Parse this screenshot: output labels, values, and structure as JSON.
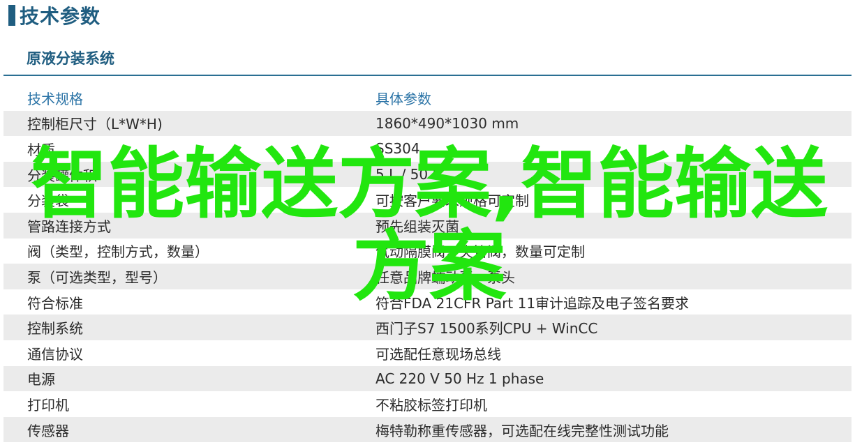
{
  "header": {
    "title": "技术参数",
    "subtitle": "原液分装系统"
  },
  "table": {
    "columns": [
      "技术规格",
      "具体参数"
    ],
    "rows": [
      [
        "控制柜尺寸（L*W*H)",
        "1860*490*1030 mm"
      ],
      [
        "材质",
        "SS304"
      ],
      [
        "分装罐体积",
        "5 L / 50 L"
      ],
      [
        "分装袋",
        "可按客户要求规格可定制"
      ],
      [
        "管路连接方式",
        "预先组装灭菌"
      ],
      [
        "阀（类型，控制方式，数量）",
        "气动隔膜阀，夹管阀，数量可定制"
      ],
      [
        "泵（可选类型，型号）",
        "任意品牌蠕动泵、泵头"
      ],
      [
        "符合标准",
        "符合FDA 21CFR Part 11审计追踪及电子签名要求"
      ],
      [
        "控制系统",
        "西门子S7 1500系列CPU + WinCC"
      ],
      [
        "通信协议",
        "可选配任意现场总线"
      ],
      [
        "电源",
        "AC 220 V 50 Hz 1 phase"
      ],
      [
        "打印机",
        "不粘胶标签打印机"
      ],
      [
        "传感器",
        "梅特勒称重传感器，可选配在线完整性测试功能"
      ]
    ]
  },
  "watermark": "智能输送方案,智能输送方案"
}
